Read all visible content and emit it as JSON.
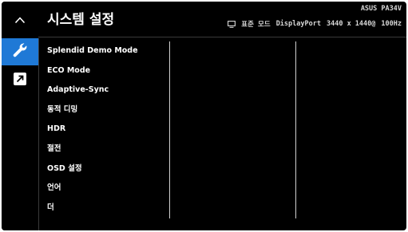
{
  "header": {
    "title": "시스템 설정",
    "brand": "ASUS PA34V",
    "status": {
      "mode": "표준 모드",
      "input": "DisplayPort",
      "resolution": "3440 x 1440@",
      "refresh": "100Hz"
    }
  },
  "sidebar": {
    "items": [
      {
        "icon": "chevron-up-icon"
      },
      {
        "icon": "wrench-icon",
        "active": true
      },
      {
        "icon": "shortcut-arrow-icon"
      }
    ],
    "accent": "#1f79d6"
  },
  "menu": {
    "items": [
      {
        "label": "Splendid Demo Mode"
      },
      {
        "label": "ECO Mode"
      },
      {
        "label": "Adaptive-Sync"
      },
      {
        "label": "동적 디밍"
      },
      {
        "label": "HDR"
      },
      {
        "label": "절전"
      },
      {
        "label": "OSD 설정"
      },
      {
        "label": "언어"
      },
      {
        "label": "더"
      }
    ]
  },
  "colors": {
    "background": "#000000",
    "text": "#ffffff",
    "accent": "#1f79d6"
  }
}
